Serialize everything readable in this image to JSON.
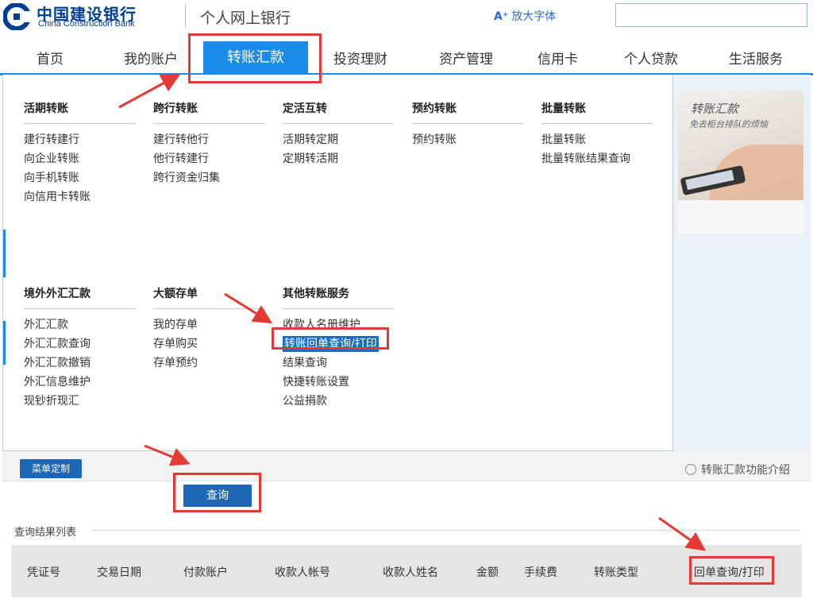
{
  "header": {
    "bank_name_cn": "中国建设银行",
    "bank_name_en": "China Construction Bank",
    "site_name": "个人网上银行",
    "enlarge_font_icon": "A⁺",
    "enlarge_font_label": "放大字体",
    "search_value": ""
  },
  "nav": {
    "items": [
      "首页",
      "我的账户",
      "转账汇款",
      "投资理财",
      "资产管理",
      "信用卡",
      "个人贷款",
      "生活服务"
    ],
    "active": "转账汇款"
  },
  "menu": {
    "columns_row1": [
      {
        "title": "活期转账",
        "links": [
          "建行转建行",
          "向企业转账",
          "向手机转账",
          "向信用卡转账"
        ]
      },
      {
        "title": "跨行转账",
        "links": [
          "建行转他行",
          "他行转建行",
          "跨行资金归集"
        ]
      },
      {
        "title": "定活互转",
        "links": [
          "活期转定期",
          "定期转活期"
        ]
      },
      {
        "title": "预约转账",
        "links": [
          "预约转账"
        ]
      },
      {
        "title": "批量转账",
        "links": [
          "批量转账",
          "批量转账结果查询"
        ]
      }
    ],
    "columns_row2": [
      {
        "title": "境外外汇汇款",
        "links": [
          "外汇汇款",
          "外汇汇款查询",
          "外汇汇款撤销",
          "外汇信息维护",
          "现钞折现汇"
        ]
      },
      {
        "title": "大额存单",
        "links": [
          "我的存单",
          "存单购买",
          "存单预约"
        ]
      },
      {
        "title": "其他转账服务",
        "links": [
          "收款人名册维护",
          "转账回单查询/打印",
          "结果查询",
          "快捷转账设置",
          "公益捐款"
        ]
      }
    ],
    "highlighted_link": "转账回单查询/打印"
  },
  "promo": {
    "title": "转账汇款",
    "subtitle": "免去柜台排队的烦恼"
  },
  "toolbar": {
    "customize_label": "菜单定制",
    "intro_label": "转账汇款功能介绍",
    "query_label": "查询"
  },
  "results": {
    "title": "查询结果列表",
    "columns": [
      "凭证号",
      "交易日期",
      "付款账户",
      "收款人帐号",
      "收款人姓名",
      "金额",
      "手续费",
      "转账类型",
      "回单查询/打印"
    ]
  },
  "annotation_color": "#e53935",
  "accent_color": "#1a8be8"
}
